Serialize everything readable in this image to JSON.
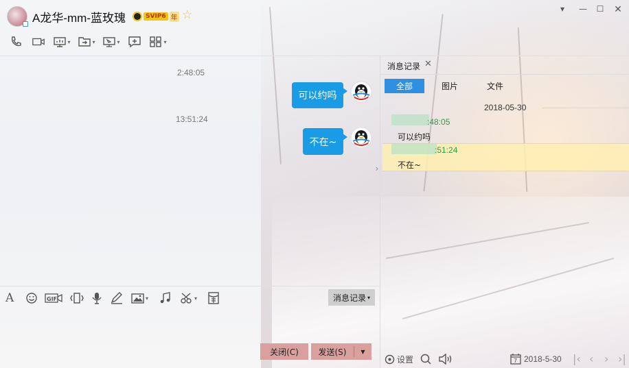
{
  "window": {
    "title": "A龙华-mm-蓝玫瑰",
    "vip_label": "SVIP6",
    "year_label": "年",
    "controls": [
      "chevron-down",
      "minimize",
      "maximize",
      "close"
    ]
  },
  "toolbar": {
    "items": [
      {
        "name": "voice-call",
        "icon": "phone-icon"
      },
      {
        "name": "video-call",
        "icon": "video-icon"
      },
      {
        "name": "screen-share",
        "icon": "screen-icon",
        "dropdown": true
      },
      {
        "name": "send-file",
        "icon": "folder-send-icon",
        "dropdown": true
      },
      {
        "name": "remote-desktop",
        "icon": "monitor-icon",
        "dropdown": true
      },
      {
        "name": "create-discussion",
        "icon": "chat-add-icon"
      },
      {
        "name": "apps",
        "icon": "apps-grid-icon",
        "dropdown": true
      }
    ]
  },
  "chat": {
    "messages": [
      {
        "time": "2:48:05",
        "text": "可以约吗"
      },
      {
        "time": "13:51:24",
        "text": "不在~"
      }
    ]
  },
  "input_toolbar": {
    "icons": [
      "font-icon",
      "emoji-icon",
      "gif-icon",
      "shake-icon",
      "voice-icon",
      "handwrite-icon",
      "image-icon",
      "music-icon",
      "scissors-icon",
      "red-packet-icon"
    ],
    "history_button": "消息记录"
  },
  "buttons": {
    "close": "关闭(C)",
    "send": "发送(S)"
  },
  "history_panel": {
    "tab_label": "消息记录",
    "filters": [
      "全部",
      "图片",
      "文件"
    ],
    "active_filter": "全部",
    "date": "2018-05-30",
    "entries": [
      {
        "time": ":48:05",
        "text": "可以约吗"
      },
      {
        "time": ":51:24",
        "text": "不在~"
      }
    ],
    "settings_label": "设置",
    "date_picker": "2018-5-30"
  },
  "colors": {
    "bubble": "#1a9be6",
    "accent": "#2f8fe0",
    "button": "#d9a09d",
    "timestamp_green": "#2f9a4a",
    "highlight": "#fff1c1"
  }
}
